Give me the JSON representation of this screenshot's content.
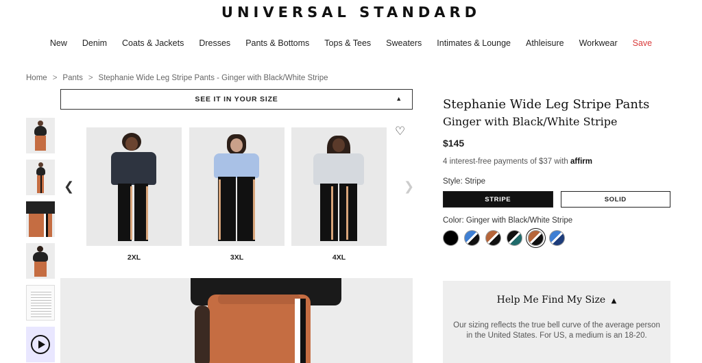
{
  "brand": {
    "logo": "UNIVERSAL STANDARD"
  },
  "nav": {
    "items": [
      "New",
      "Denim",
      "Coats & Jackets",
      "Dresses",
      "Pants & Bottoms",
      "Tops & Tees",
      "Sweaters",
      "Intimates & Lounge",
      "Athleisure",
      "Workwear"
    ],
    "sale": "Save"
  },
  "breadcrumb": {
    "home": "Home",
    "category": "Pants",
    "current": "Stephanie Wide Leg Stripe Pants - Ginger with Black/White Stripe",
    "separator": ">"
  },
  "gallery": {
    "size_bar_label": "SEE IT IN YOUR SIZE",
    "cards": [
      {
        "size": "2XL"
      },
      {
        "size": "3XL"
      },
      {
        "size": "4XL"
      }
    ]
  },
  "product": {
    "title": "Stephanie Wide Leg Stripe Pants",
    "color_name": "Ginger with Black/White Stripe",
    "price": "$145",
    "affirm_text": "4 interest-free payments of $37 with",
    "affirm_brand": "affirm",
    "style_label": "Style: Stripe",
    "style_options": [
      "STRIPE",
      "SOLID"
    ],
    "color_label": "Color: Ginger with Black/White Stripe"
  },
  "help": {
    "title": "Help Me Find My Size",
    "text": "Our sizing reflects the true bell curve of the average person in the United States. For US, a medium is an 18-20."
  },
  "colors": {
    "sale": "#d93a3a",
    "ginger": "#b5653a",
    "blue": "#3f7fd3"
  }
}
